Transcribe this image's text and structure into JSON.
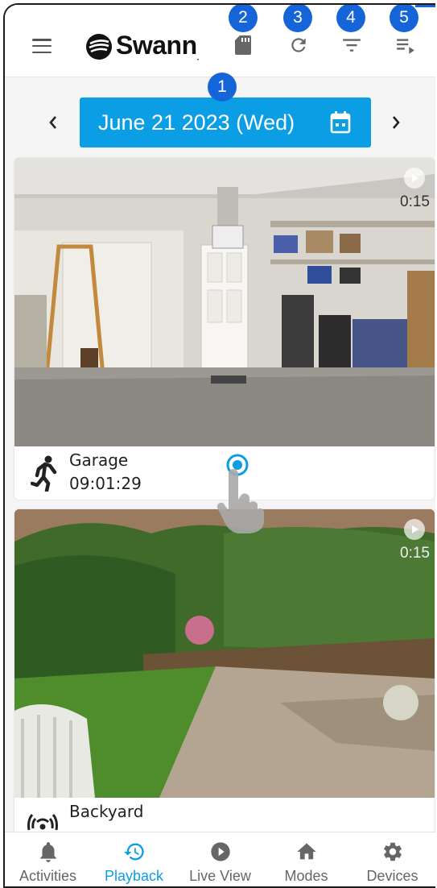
{
  "header": {
    "logo_text": "Swann",
    "logo_suffix": ".",
    "buttons": [
      {
        "icon": "sd-card-icon"
      },
      {
        "icon": "refresh-icon"
      },
      {
        "icon": "filter-icon"
      },
      {
        "icon": "playlist-play-icon"
      }
    ]
  },
  "callouts": [
    "1",
    "2",
    "3",
    "4",
    "5"
  ],
  "date_selector": {
    "label": "June 21 2023 (Wed)",
    "icon": "calendar-icon"
  },
  "events": [
    {
      "camera": "Garage",
      "time": "09:01:29",
      "duration": "0:15",
      "event_icon": "motion-person-icon"
    },
    {
      "camera": "Backyard",
      "time": "",
      "duration": "0:15",
      "event_icon": "wireless-signal-icon"
    }
  ],
  "tabs": [
    {
      "label": "Activities",
      "icon": "bell-icon",
      "active": false
    },
    {
      "label": "Playback",
      "icon": "history-icon",
      "active": true
    },
    {
      "label": "Live View",
      "icon": "play-circle-icon",
      "active": false
    },
    {
      "label": "Modes",
      "icon": "home-icon",
      "active": false
    },
    {
      "label": "Devices",
      "icon": "gear-icon",
      "active": false
    }
  ],
  "colors": {
    "accent": "#0c9ee4",
    "callout": "#1565d8",
    "tab_inactive": "#666666"
  }
}
